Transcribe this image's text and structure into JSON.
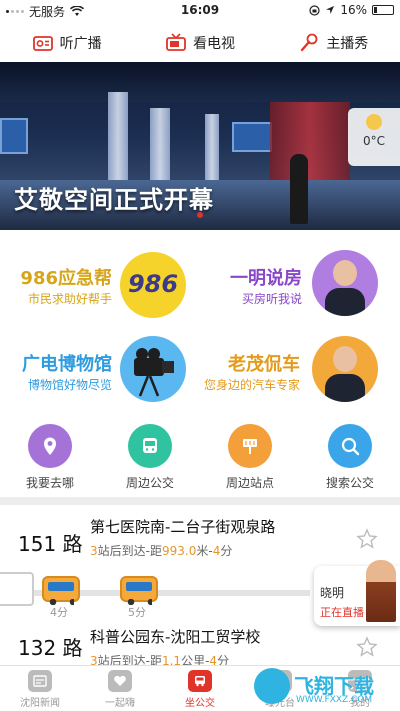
{
  "status_bar": {
    "carrier": "无服务",
    "time": "16:09",
    "battery": "16%",
    "battery_level": 0.16
  },
  "media_nav": [
    {
      "label": "听广播",
      "icon": "radio-icon"
    },
    {
      "label": "看电视",
      "icon": "tv-icon"
    },
    {
      "label": "主播秀",
      "icon": "microphone-icon"
    }
  ],
  "banner": {
    "title": "艾敬空间正式开幕",
    "weather_temp": "0°C",
    "weather_icon": "lightbulb-icon"
  },
  "features": [
    {
      "title": "986应急帮",
      "subtitle": "市民求助好帮手",
      "badge": "986"
    },
    {
      "title": "一明说房",
      "subtitle": "买房听我说"
    },
    {
      "title": "广电博物馆",
      "subtitle": "博物馆好物尽览"
    },
    {
      "title": "老茂侃车",
      "subtitle": "您身边的汽车专家"
    }
  ],
  "quick_actions": [
    {
      "label": "我要去哪",
      "icon": "location-pin-icon"
    },
    {
      "label": "周边公交",
      "icon": "bus-icon"
    },
    {
      "label": "周边站点",
      "icon": "bus-stop-icon"
    },
    {
      "label": "搜索公交",
      "icon": "search-icon"
    }
  ],
  "routes": [
    {
      "number": "151 路",
      "destination": "第七医院南-二台子街观泉路",
      "eta_stops": "3",
      "eta_text_a": "站后到达-距",
      "eta_distance": "993.0",
      "eta_text_b": "米-",
      "eta_minutes": "4",
      "eta_text_c": "分",
      "buses": [
        {
          "label": "4分"
        },
        {
          "label": "5分"
        }
      ]
    },
    {
      "number": "132 路",
      "destination": "科普公园东-沈阳工贸学校",
      "eta_stops": "3",
      "eta_text_a": "站后到达-距",
      "eta_distance": "1.1",
      "eta_text_b": "公里-",
      "eta_minutes": "4",
      "eta_text_c": "分"
    }
  ],
  "live_anchor": {
    "name": "晓明",
    "status": "正在直播"
  },
  "tabbar": [
    {
      "label": "沈阳新闻",
      "active": false
    },
    {
      "label": "一起嗨",
      "active": false
    },
    {
      "label": "坐公交",
      "active": true
    },
    {
      "label": "曝光台",
      "active": false
    },
    {
      "label": "我的",
      "active": false
    }
  ],
  "watermark": {
    "text": "飞翔下载",
    "url": "WWW.FXXZ.COM"
  },
  "colors": {
    "accent": "#e0332a",
    "eta_highlight": "#e7962c"
  }
}
